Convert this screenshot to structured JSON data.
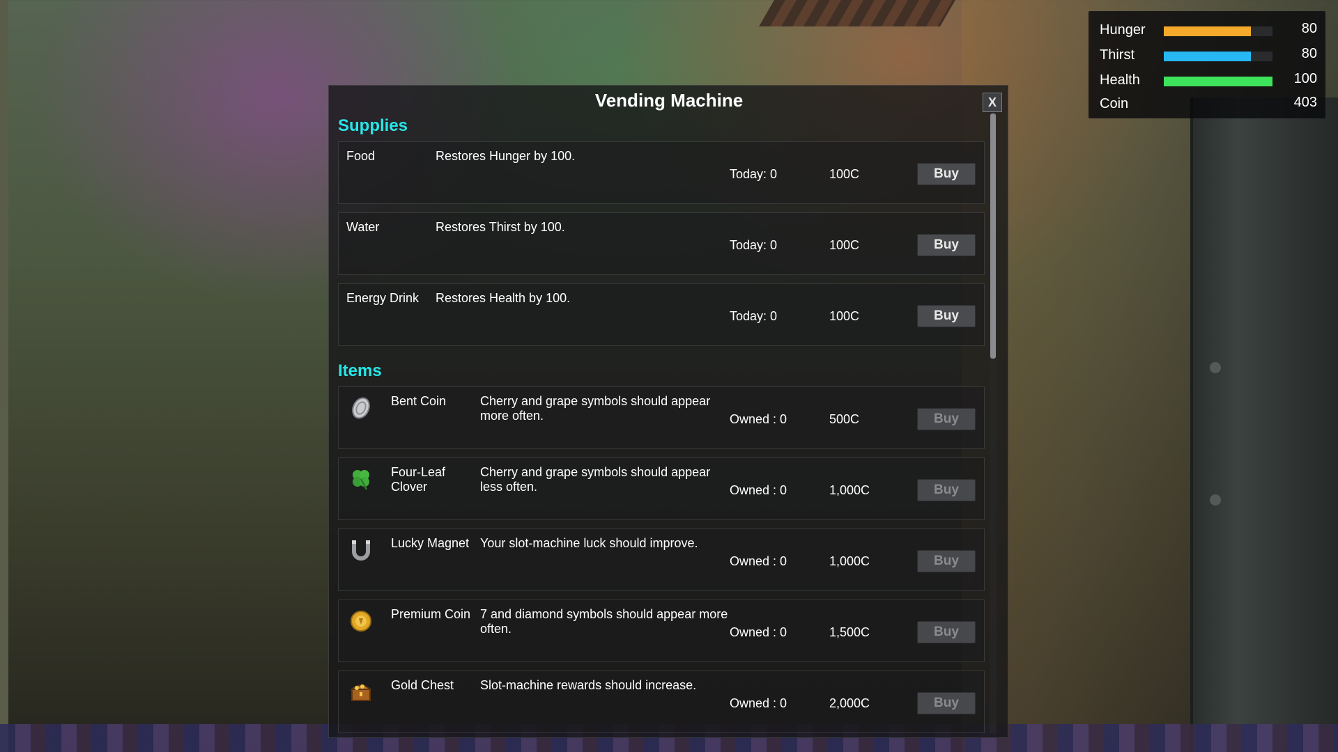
{
  "hud": {
    "stats": [
      {
        "label": "Hunger",
        "value": "80",
        "fill": 0.8,
        "color": "#f6aa2c"
      },
      {
        "label": "Thirst",
        "value": "80",
        "fill": 0.8,
        "color": "#27b7f3"
      },
      {
        "label": "Health",
        "value": "100",
        "fill": 1.0,
        "color": "#3de35a"
      }
    ],
    "coin": {
      "label": "Coin",
      "value": "403"
    }
  },
  "modal": {
    "title": "Vending Machine",
    "close_label": "X",
    "supplies": {
      "heading": "Supplies",
      "rows": [
        {
          "name": "Food",
          "description": "Restores Hunger by 100.",
          "count": "Today: 0",
          "price": "100C",
          "buy_label": "Buy"
        },
        {
          "name": "Water",
          "description": "Restores Thirst by 100.",
          "count": "Today: 0",
          "price": "100C",
          "buy_label": "Buy"
        },
        {
          "name": "Energy Drink",
          "description": "Restores Health by 100.",
          "count": "Today: 0",
          "price": "100C",
          "buy_label": "Buy"
        }
      ]
    },
    "items": {
      "heading": "Items",
      "rows": [
        {
          "name": "Bent Coin",
          "icon": "bent-coin-icon",
          "description": "Cherry and grape symbols should appear more often.",
          "count": "Owned : 0",
          "price": "500C",
          "buy_label": "Buy"
        },
        {
          "name": "Four-Leaf Clover",
          "icon": "four-leaf-clover-icon",
          "description": "Cherry and grape symbols should appear less often.",
          "count": "Owned : 0",
          "price": "1,000C",
          "buy_label": "Buy"
        },
        {
          "name": "Lucky Magnet",
          "icon": "horseshoe-magnet-icon",
          "description": "Your slot-machine luck should improve.",
          "count": "Owned : 0",
          "price": "1,000C",
          "buy_label": "Buy"
        },
        {
          "name": "Premium Coin",
          "icon": "gold-coin-icon",
          "description": "7 and diamond symbols should appear more often.",
          "count": "Owned : 0",
          "price": "1,500C",
          "buy_label": "Buy"
        },
        {
          "name": "Gold Chest",
          "icon": "gold-chest-icon",
          "description": "Slot-machine rewards should increase.",
          "count": "Owned : 0",
          "price": "2,000C",
          "buy_label": "Buy"
        }
      ]
    }
  }
}
